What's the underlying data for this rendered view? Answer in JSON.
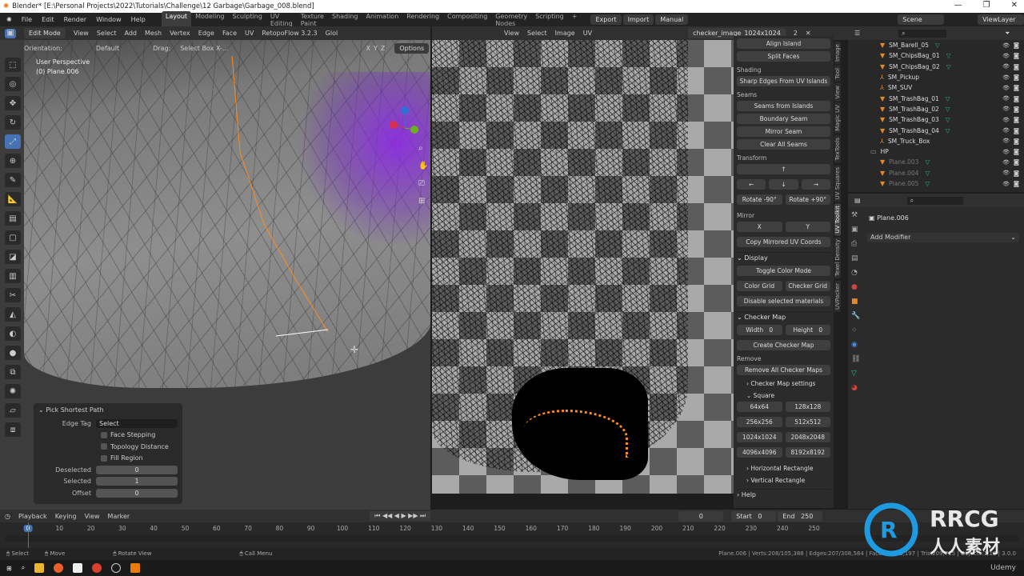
{
  "window": {
    "title": "Blender* [E:\\Personal Projects\\2022\\Tutorials\\Challenge\\12 Garbage\\Garbage_008.blend]",
    "controls": [
      "—",
      "❐",
      "✕"
    ]
  },
  "menu": {
    "items": [
      "File",
      "Edit",
      "Render",
      "Window",
      "Help"
    ],
    "workspaces": [
      "Layout",
      "Modeling",
      "Sculpting",
      "UV Editing",
      "Texture Paint",
      "Shading",
      "Animation",
      "Rendering",
      "Compositing",
      "Geometry Nodes",
      "Scripting"
    ],
    "active_workspace": "Layout",
    "add": "+",
    "export": "Export",
    "import": "Import",
    "manual": "Manual",
    "scene": "Scene",
    "view_layer": "ViewLayer"
  },
  "viewport": {
    "mode": "Edit Mode",
    "menus": [
      "View",
      "Select",
      "Add",
      "Mesh",
      "Vertex",
      "Edge",
      "Face",
      "UV"
    ],
    "addon": "RetopoFlow 3.2.3",
    "transform": "Glol",
    "orientation_label": "Orientation:",
    "orientation": "Default",
    "drag_label": "Drag:",
    "drag": "Select Box X-...",
    "axes": [
      "X",
      "Y",
      "Z"
    ],
    "options": "Options",
    "perspective": "User Perspective",
    "object": "(0) Plane.006"
  },
  "last_op": {
    "title": "Pick Shortest Path",
    "edge_tag_label": "Edge Tag",
    "edge_tag": "Select",
    "checks": [
      {
        "label": "Face Stepping",
        "checked": false
      },
      {
        "label": "Topology Distance",
        "checked": false
      },
      {
        "label": "Fill Region",
        "checked": false
      }
    ],
    "fields": [
      {
        "label": "Deselected",
        "value": "0"
      },
      {
        "label": "Selected",
        "value": "1"
      },
      {
        "label": "Offset",
        "value": "0"
      }
    ]
  },
  "uv_editor": {
    "menus": [
      "View",
      "Select",
      "Image",
      "UV"
    ],
    "image": "checker_image_1024x1024",
    "users": "2"
  },
  "npanel": {
    "align_island": "Align Island",
    "split_faces": "Split Faces",
    "shading": "Shading",
    "sharp_edges": "Sharp Edges From UV Islands",
    "seams": "Seams",
    "seams_from_islands": "Seams from Islands",
    "boundary_seam": "Boundary Seam",
    "mirror_seam": "Mirror Seam",
    "clear_seams": "Clear All Seams",
    "transform": "Transform",
    "up": "↑",
    "left": "←",
    "down": "↓",
    "right": "→",
    "rot_neg": "Rotate -90°",
    "rot_pos": "Rotate +90°",
    "mirror": "Mirror",
    "x": "X",
    "y": "Y",
    "copy_mirrored": "Copy Mirrored UV Coords",
    "display": "Display",
    "toggle_color": "Toggle Color Mode",
    "color_grid": "Color Grid",
    "checker_grid": "Checker Grid",
    "disable_materials": "Disable selected materials",
    "checker_map": "Checker Map",
    "width_label": "Width",
    "width": "0",
    "height_label": "Height",
    "height": "0",
    "create_checker": "Create Checker Map",
    "remove": "Remove",
    "remove_all": "Remove All Checker Maps",
    "checker_settings": "Checker Map settings",
    "square": "Square",
    "sizes": [
      "64x64",
      "128x128",
      "256x256",
      "512x512",
      "1024x1024",
      "2048x2048",
      "4096x4096",
      "8192x8192"
    ],
    "horizontal": "Horizontal Rectangle",
    "vertical": "Vertical Rectangle",
    "help": "Help"
  },
  "side_tabs": [
    "Image",
    "Tool",
    "View",
    "Magic UV",
    "TexTools",
    "UV Squares",
    "UV Toolkit",
    "Texel Density",
    "UVPacker"
  ],
  "outliner": {
    "items": [
      {
        "name": "SM_Barell_05",
        "type": "mesh"
      },
      {
        "name": "SM_ChipsBag_01",
        "type": "mesh"
      },
      {
        "name": "SM_ChipsBag_02",
        "type": "mesh"
      },
      {
        "name": "SM_Pickup",
        "type": "empty"
      },
      {
        "name": "SM_SUV",
        "type": "empty"
      },
      {
        "name": "SM_TrashBag_01",
        "type": "mesh"
      },
      {
        "name": "SM_TrashBag_02",
        "type": "mesh"
      },
      {
        "name": "SM_TrashBag_03",
        "type": "mesh"
      },
      {
        "name": "SM_TrashBag_04",
        "type": "mesh"
      },
      {
        "name": "SM_Truck_Box",
        "type": "empty"
      },
      {
        "name": "HP",
        "type": "collection"
      },
      {
        "name": "Plane.003",
        "type": "mesh",
        "dim": true
      },
      {
        "name": "Plane.004",
        "type": "mesh",
        "dim": true
      },
      {
        "name": "Plane.005",
        "type": "mesh",
        "dim": true
      }
    ]
  },
  "properties": {
    "object": "Plane.006",
    "add_modifier": "Add Modifier"
  },
  "timeline": {
    "menus": [
      "Playback",
      "Keying",
      "View",
      "Marker"
    ],
    "current_frame": "0",
    "start_label": "Start",
    "start": "0",
    "end_label": "End",
    "end": "250",
    "ticks": [
      "0",
      "10",
      "20",
      "30",
      "40",
      "50",
      "60",
      "70",
      "80",
      "90",
      "100",
      "110",
      "120",
      "130",
      "140",
      "150",
      "160",
      "170",
      "180",
      "190",
      "200",
      "210",
      "220",
      "230",
      "240",
      "250"
    ]
  },
  "status": {
    "select": "Select",
    "move": "Move",
    "rotate": "Rotate View",
    "call_menu": "Call Menu",
    "stats": "Plane.006 | Verts:208/105,388 | Edges:207/308,584 | Faces:0/203,197 | Tris:209,715 | Objects:1/18 | 3.0.0"
  },
  "watermark": {
    "brand": "RRCG",
    "sub": "人人素材",
    "udemy": "Udemy"
  },
  "colors": {
    "accent": "#4772b3",
    "selection_orange": "#ff8a1e",
    "purple_glow": "#8c28e6",
    "modifier_green": "#2cb08a"
  }
}
